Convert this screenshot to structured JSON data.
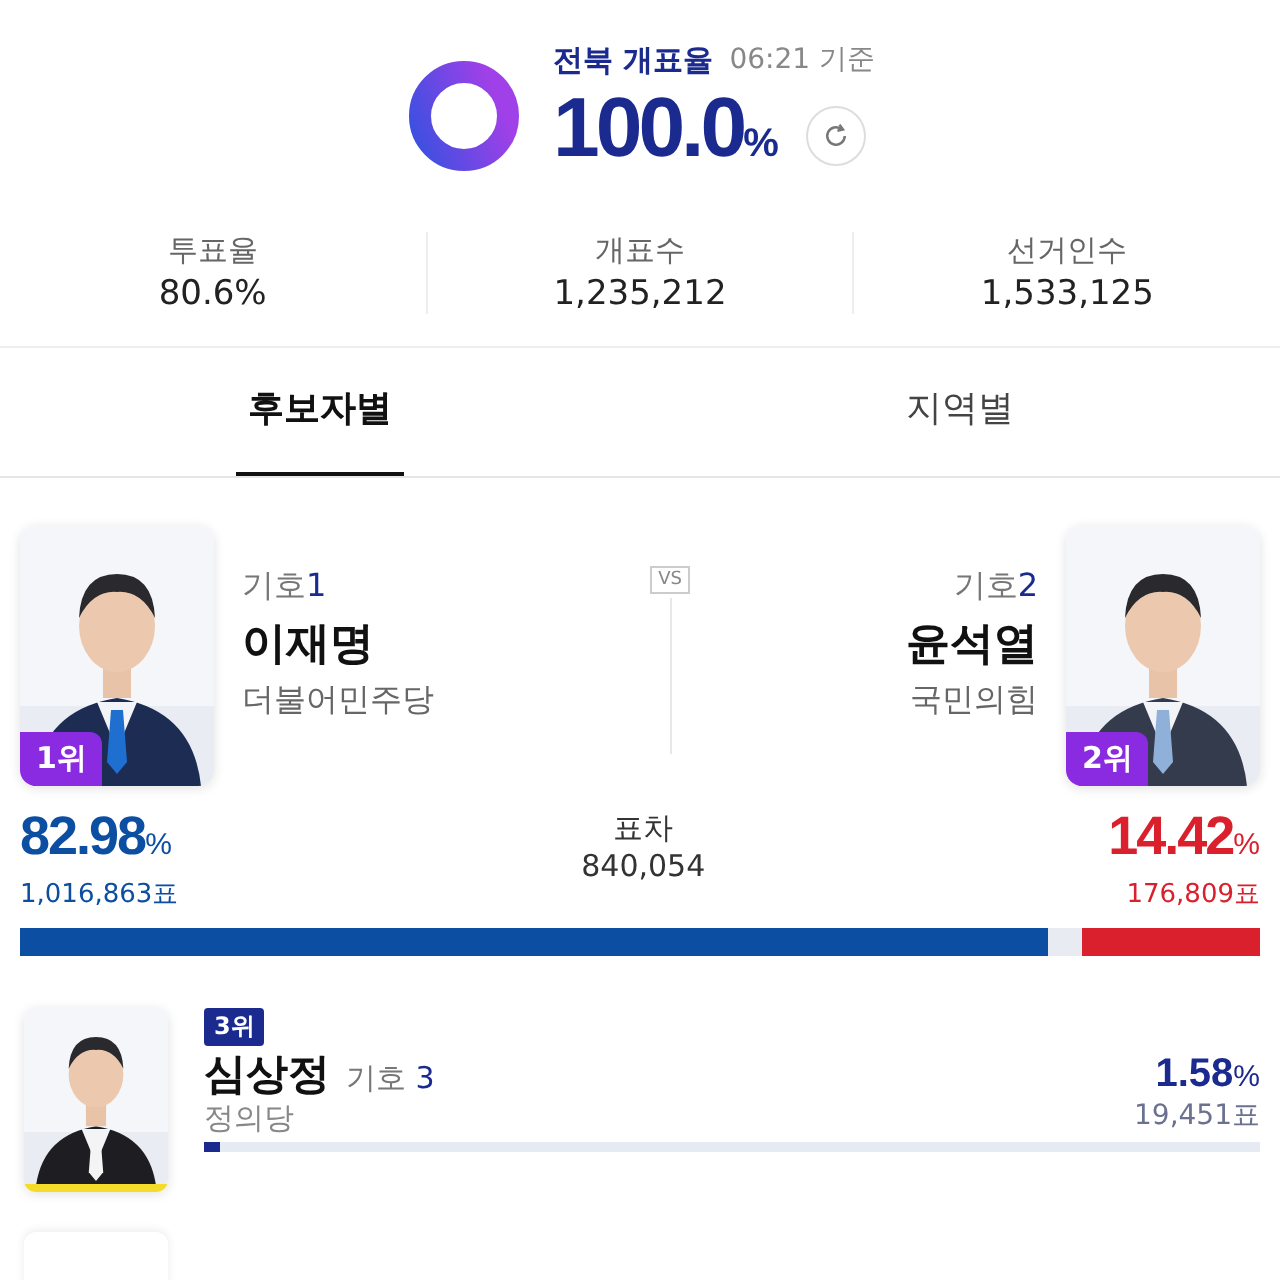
{
  "header": {
    "title": "전북 개표율",
    "time": "06:21 기준",
    "rate": "100.0",
    "unit": "%"
  },
  "stats": [
    {
      "label": "투표율",
      "value": "80.6%"
    },
    {
      "label": "개표수",
      "value": "1,235,212"
    },
    {
      "label": "선거인수",
      "value": "1,533,125"
    }
  ],
  "tabs": [
    {
      "label": "후보자별",
      "selected": true
    },
    {
      "label": "지역별",
      "selected": false
    }
  ],
  "matchup": {
    "vs": "VS",
    "diff_label": "표차",
    "diff_value": "840,054",
    "candidates": [
      {
        "rank": "1위",
        "number_label": "기호",
        "number": "1",
        "name": "이재명",
        "party": "더불어민주당",
        "pct": "82.98",
        "unit": "%",
        "votes": "1,016,863표",
        "level": 0.8298,
        "color": "#0b4ea2"
      },
      {
        "rank": "2위",
        "number_label": "기호",
        "number": "2",
        "name": "윤석열",
        "party": "국민의힘",
        "pct": "14.42",
        "unit": "%",
        "votes": "176,809표",
        "level": 0.1442,
        "color": "#d9202c"
      }
    ]
  },
  "others": [
    {
      "rank": "3위",
      "name": "심상정",
      "number_label": "기호",
      "number": "3",
      "party": "정의당",
      "pct": "1.58",
      "unit": "%",
      "votes": "19,451표",
      "level": 0.0158,
      "color": "#1b2a8f"
    }
  ]
}
